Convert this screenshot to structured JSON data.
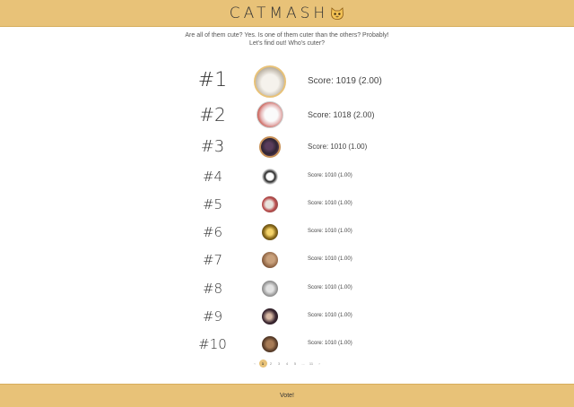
{
  "header": {
    "title": "CATMASH",
    "icon": "cat-face-icon"
  },
  "subtitle": {
    "line1": "Are all of them cute? Yes. Is one of them cuter than the others? Probably!",
    "line2": "Let's find out! Who's cuter?"
  },
  "ranking": [
    {
      "rank": "#1",
      "score": "Score: 1019 (2.00)",
      "photo": "white-fluffy-cat-photo"
    },
    {
      "rank": "#2",
      "score": "Score: 1018 (2.00)",
      "photo": "white-cat-red-background-photo"
    },
    {
      "rank": "#3",
      "score": "Score: 1010 (1.00)",
      "photo": "cat-with-person-photo"
    },
    {
      "rank": "#4",
      "score": "Score: 1010 (1.00)",
      "photo": "black-white-cat-photo"
    },
    {
      "rank": "#5",
      "score": "Score: 1010 (1.00)",
      "photo": "cat-with-red-toy-photo"
    },
    {
      "rank": "#6",
      "score": "Score: 1010 (1.00)",
      "photo": "cat-golden-light-photo"
    },
    {
      "rank": "#7",
      "score": "Score: 1010 (1.00)",
      "photo": "brown-cat-closeup-photo"
    },
    {
      "rank": "#8",
      "score": "Score: 1010 (1.00)",
      "photo": "grey-cat-face-photo"
    },
    {
      "rank": "#9",
      "score": "Score: 1010 (1.00)",
      "photo": "cat-dark-portrait-photo"
    },
    {
      "rank": "#10",
      "score": "Score: 1010 (1.00)",
      "photo": "tabby-cat-photo"
    }
  ],
  "pagination": {
    "prev": "‹",
    "pages": [
      "1",
      "2",
      "3",
      "4",
      "5",
      "...",
      "11"
    ],
    "active": "1",
    "next": "›"
  },
  "footer": {
    "vote_label": "Vote!"
  },
  "colors": {
    "accent": "#e8c278",
    "accent_border": "#d6ad5c",
    "text": "#333333"
  }
}
